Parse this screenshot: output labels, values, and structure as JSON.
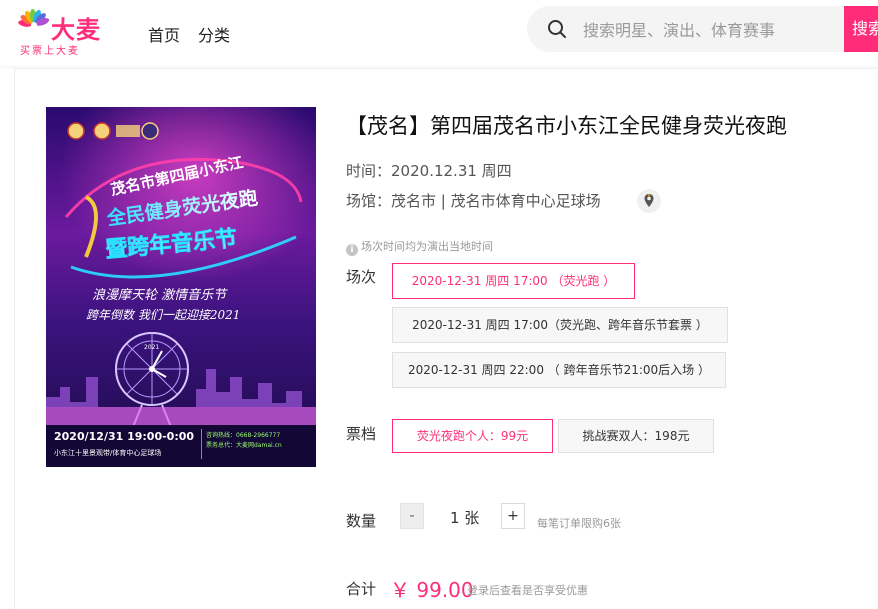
{
  "brand": {
    "name": "大麦",
    "slogan": "买票上大麦",
    "color": "#ff2d79"
  },
  "nav": {
    "items": [
      "首页",
      "分类"
    ]
  },
  "search": {
    "placeholder": "搜索明星、演出、体育赛事",
    "button_label": "搜索"
  },
  "event": {
    "title": "【茂名】第四届茂名市小东江全民健身荧光夜跑",
    "time_label": "时间：",
    "time_value": "2020.12.31 周四",
    "venue_label": "场馆：",
    "venue_value": "茂名市 | 茂名市体育中心足球场",
    "notice": "场次时间均为演出当地时间"
  },
  "poster": {
    "title_line1": "茂名市第四届小东江",
    "title_line2": "全民健身荧光夜跑",
    "title_line3": "暨跨年音乐节",
    "slogan_line1": "浪漫摩天轮   激情音乐节",
    "slogan_line2": "跨年倒数 我们一起迎接2021",
    "datetime": "2020/12/31 19:00-0:00",
    "location": "小东江十里景观带/体育中心足球场",
    "hotline": "咨询热线：0668-2966777",
    "ticket_agent": "票务总代：大麦网damai.cn",
    "wheel_year": "2021"
  },
  "sessions": {
    "label": "场次",
    "options": [
      {
        "text": "2020-12-31 周四 17:00 （荧光跑 ）",
        "selected": true
      },
      {
        "text": "2020-12-31 周四 17:00（荧光跑、跨年音乐节套票 ）",
        "selected": false
      },
      {
        "text": "2020-12-31 周四 22:00 （ 跨年音乐节21:00后入场 ）",
        "selected": false
      }
    ]
  },
  "tiers": {
    "label": "票档",
    "options": [
      {
        "text": "荧光夜跑个人：99元",
        "selected": true
      },
      {
        "text": "挑战赛双人：198元",
        "selected": false
      }
    ]
  },
  "quantity": {
    "label": "数量",
    "minus": "-",
    "value": "1 张",
    "plus": "+",
    "limit_note": "每笔订单限购6张"
  },
  "total": {
    "label": "合计",
    "price": "￥ 99.00",
    "note": "登录后查看是否享受优惠"
  }
}
